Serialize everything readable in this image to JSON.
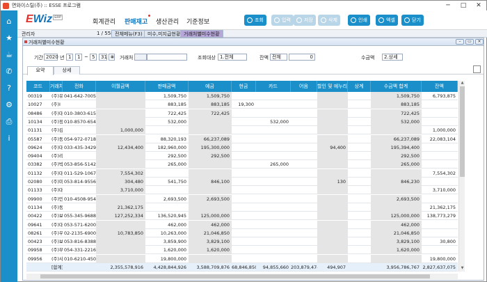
{
  "window": {
    "title": "면와이스틸(주) :: ESSE 프로그램",
    "minimize": "─",
    "maximize": "□",
    "close": "✕"
  },
  "sidebar": [
    {
      "icon": "home-icon",
      "glyph": "⌂"
    },
    {
      "icon": "star-icon",
      "glyph": "★"
    },
    {
      "icon": "coffee-icon",
      "glyph": "☕"
    },
    {
      "icon": "phone-icon",
      "glyph": "✆"
    },
    {
      "icon": "help-icon",
      "glyph": "?"
    },
    {
      "icon": "gear-icon",
      "glyph": "⚙"
    },
    {
      "icon": "printer-icon",
      "glyph": "⎙"
    },
    {
      "icon": "info-icon",
      "glyph": "i"
    }
  ],
  "logo": {
    "text": "Wiz",
    "badge": "ERP"
  },
  "menu": [
    "회계관리",
    "판매재고",
    "생산관리",
    "기준정보"
  ],
  "toolbar": [
    {
      "label": "조회",
      "enabled": true
    },
    {
      "label": "입력",
      "enabled": false
    },
    {
      "label": "저장",
      "enabled": false
    },
    {
      "label": "삭제",
      "enabled": false
    },
    {
      "label": "인쇄",
      "enabled": true
    },
    {
      "label": "엑셀",
      "enabled": true
    },
    {
      "label": "닫기",
      "enabled": true
    }
  ],
  "infobar": {
    "label": "관리자",
    "count": "1 / 558",
    "tabs": [
      "전체메뉴(F3)",
      "미수,미지급현황",
      "거래처별미수현황"
    ]
  },
  "inner": {
    "title": "거래처별미수현황"
  },
  "filters": {
    "period_label": "기간",
    "year": "2020",
    "year_suffix": "년",
    "m1": "1",
    "d1": "1",
    "tilde": "~",
    "m2": "5",
    "d2": "31",
    "client_label": "거래처",
    "client_value": "",
    "target_label": "조회대상",
    "target_value": "1.전체",
    "balance_label": "잔액",
    "balance_value": "전체",
    "balance_amount": "0",
    "receipt_label": "수금액",
    "receipt_value": "2.상세"
  },
  "tabs": [
    "요약",
    "상세"
  ],
  "columns": [
    "코드",
    "거래처",
    "전화",
    "이월금액",
    "판매금액",
    "예금",
    "현금",
    "카드",
    "어음",
    "할인 및 에누리",
    "상계",
    "수금액 합계",
    "잔액"
  ],
  "rows": [
    [
      "00319",
      "(주)유",
      "041-642-7005",
      "",
      "1,509,750",
      "1,509,750",
      "",
      "",
      "",
      "",
      "",
      "1,509,750",
      "6,793,875"
    ],
    [
      "10027",
      "(주)I",
      "",
      "",
      "883,185",
      "883,185",
      "19,300",
      "",
      "",
      "",
      "",
      "883,185",
      ""
    ],
    [
      "08486",
      "(주)대",
      "010-3803-6157",
      "",
      "722,425",
      "722,425",
      "",
      "",
      "",
      "",
      "",
      "722,425",
      ""
    ],
    [
      "10134",
      "(주)정",
      "010-8570-6547",
      "",
      "532,000",
      "",
      "",
      "532,000",
      "",
      "",
      "",
      "532,000",
      ""
    ],
    [
      "01131",
      "(주)김",
      "",
      "1,000,000",
      "",
      "",
      "",
      "",
      "",
      "",
      "",
      "",
      "1,000,000"
    ],
    [
      "05587",
      "(주)동",
      "054-972-0718",
      "",
      "88,320,193",
      "66,237,089",
      "",
      "",
      "",
      "",
      "",
      "66,237,089",
      "22,083,104"
    ],
    [
      "09624",
      "(주)대",
      "033-435-3429",
      "12,434,400",
      "182,960,000",
      "195,300,000",
      "",
      "",
      "",
      "94,400",
      "",
      "195,394,400",
      ""
    ],
    [
      "09404",
      "(주)리",
      "",
      "",
      "292,500",
      "292,500",
      "",
      "",
      "",
      "",
      "",
      "292,500",
      ""
    ],
    [
      "03382",
      "(주)박",
      "053-856-5142",
      "",
      "265,000",
      "",
      "",
      "265,000",
      "",
      "",
      "",
      "265,000",
      ""
    ],
    [
      "01132",
      "(주)대",
      "011-529-1067",
      "7,554,302",
      "",
      "",
      "",
      "",
      "",
      "",
      "",
      "",
      "7,554,302"
    ],
    [
      "02080",
      "(주)미",
      "053-814-9556",
      "304,480",
      "541,750",
      "846,100",
      "",
      "",
      "",
      "130",
      "",
      "846,230",
      ""
    ],
    [
      "01133",
      "(주)대",
      "",
      "3,710,000",
      "",
      "",
      "",
      "",
      "",
      "",
      "",
      "",
      "3,710,000"
    ],
    [
      "09900",
      "(주)민",
      "010-4508-9548",
      "",
      "2,693,500",
      "2,693,500",
      "",
      "",
      "",
      "",
      "",
      "2,693,500",
      ""
    ],
    [
      "01134",
      "(주)동",
      "",
      "21,362,175",
      "",
      "",
      "",
      "",
      "",
      "",
      "",
      "",
      "21,362,175"
    ],
    [
      "00422",
      "(주)보",
      "055-345-9688",
      "127,252,334",
      "136,520,945",
      "125,000,000",
      "",
      "",
      "",
      "",
      "",
      "125,000,000",
      "138,773,279"
    ],
    [
      "09641",
      "(주)대",
      "053-571-6200",
      "",
      "462,000",
      "462,000",
      "",
      "",
      "",
      "",
      "",
      "462,000",
      ""
    ],
    [
      "08261",
      "(주)우",
      "02-2135-6900",
      "10,783,850",
      "10,263,000",
      "21,046,850",
      "",
      "",
      "",
      "",
      "",
      "21,046,850",
      ""
    ],
    [
      "00423",
      "(주)보",
      "053-816-8388",
      "",
      "3,859,900",
      "3,829,100",
      "",
      "",
      "",
      "",
      "",
      "3,829,100",
      "30,800"
    ],
    [
      "09958",
      "(주)부",
      "054-331-2216",
      "",
      "1,620,000",
      "1,620,000",
      "",
      "",
      "",
      "",
      "",
      "1,620,000",
      ""
    ],
    [
      "09956",
      "(주)사",
      "010-6210-4500",
      "",
      "19,800,000",
      "",
      "",
      "",
      "",
      "",
      "",
      "",
      "19,800,000"
    ]
  ],
  "total": [
    "",
    "[합계]",
    "",
    "2,355,578,916",
    "4,428,844,926",
    "3,588,709,876",
    "68,846,850",
    "94,855,660",
    "203,879,474",
    "494,907",
    "",
    "3,956,786,767",
    "2,827,637,075"
  ]
}
